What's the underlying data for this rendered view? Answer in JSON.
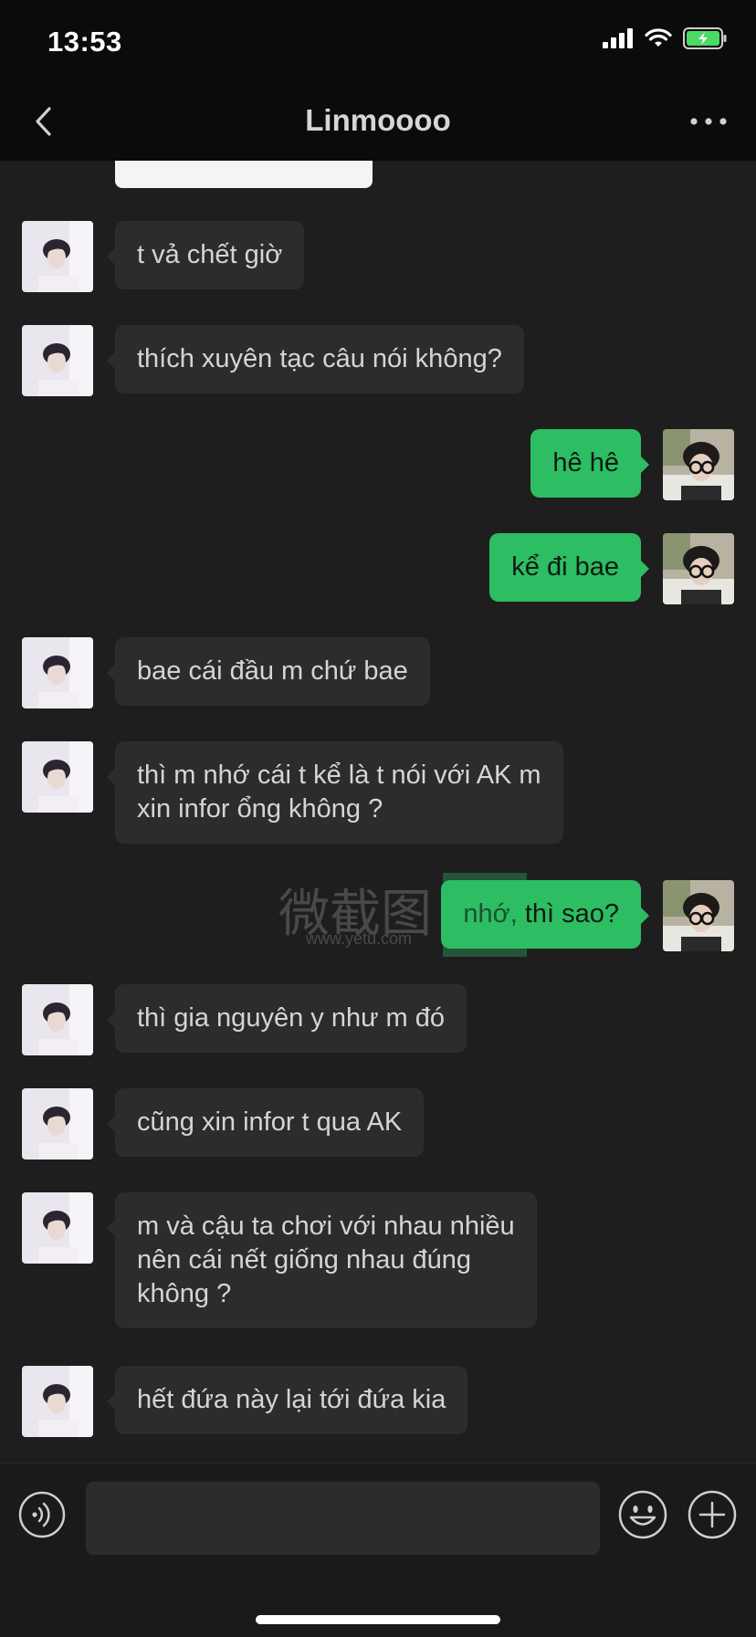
{
  "status_bar": {
    "time": "13:53"
  },
  "header": {
    "title": "Linmoooo"
  },
  "watermark": {
    "text": "微截图",
    "url": "www.yetu.com"
  },
  "messages": [
    {
      "side": "in",
      "text": "t vả chết giờ"
    },
    {
      "side": "in",
      "text": "thích xuyên tạc câu nói không?"
    },
    {
      "side": "out",
      "text": "hê hê"
    },
    {
      "side": "out",
      "text": "kể đi bae"
    },
    {
      "side": "in",
      "text": "bae cái đầu m chứ bae"
    },
    {
      "side": "in",
      "text": "thì m nhớ cái t kể là t nói với AK m\nxin infor ổng không ?"
    },
    {
      "side": "out",
      "text": "nhớ, thì sao?"
    },
    {
      "side": "in",
      "text": "thì gia nguyên y như m đó"
    },
    {
      "side": "in",
      "text": "cũng xin infor t qua AK"
    },
    {
      "side": "in",
      "text": "m và cậu ta chơi với nhau nhiều\nnên cái nết giống nhau đúng\nkhông ?"
    },
    {
      "side": "in",
      "text": "hết đứa này lại tới đứa kia"
    }
  ],
  "input": {
    "value": ""
  },
  "icons": {
    "back": "chevron-left-icon",
    "more": "more-dots-icon",
    "voice": "voice-icon",
    "emoji": "emoji-icon",
    "plus": "plus-icon"
  },
  "colors": {
    "outgoing": "#2dbd63",
    "incoming": "#2c2c2c",
    "background": "#1e1e1e"
  }
}
